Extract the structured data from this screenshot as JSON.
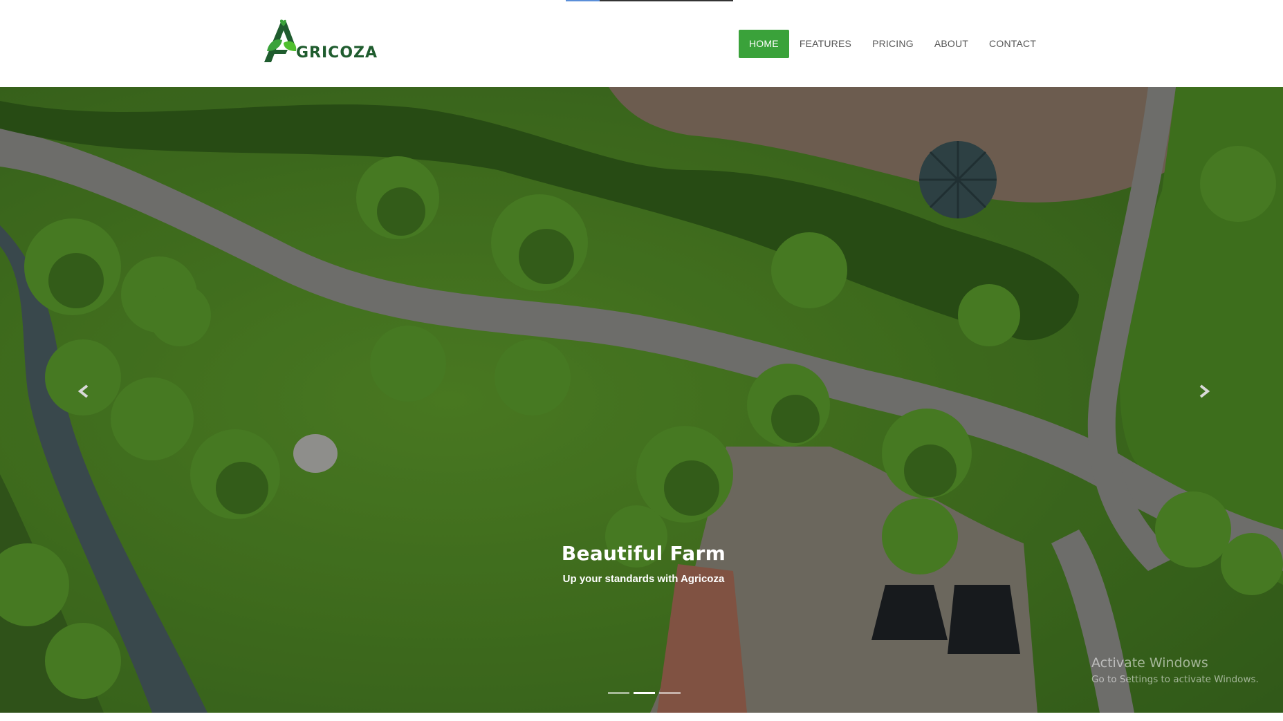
{
  "brand": {
    "name": "GRICOZA",
    "mark": "A"
  },
  "nav": {
    "items": [
      {
        "label": "HOME",
        "active": true
      },
      {
        "label": "FEATURES",
        "active": false
      },
      {
        "label": "PRICING",
        "active": false
      },
      {
        "label": "ABOUT",
        "active": false
      },
      {
        "label": "CONTACT",
        "active": false
      }
    ]
  },
  "hero": {
    "title": "Beautiful Farm",
    "subtitle": "Up your standards with Agricoza",
    "prev_icon": "chevron-left-icon",
    "next_icon": "chevron-right-icon",
    "slides_count": 3,
    "active_slide": 2
  },
  "watermark": {
    "line1": "Activate Windows",
    "line2": "Go to Settings to activate Windows."
  },
  "colors": {
    "accent": "#3aa23a",
    "nav_text": "#555555",
    "logo_dark": "#1f5c2e",
    "grass": "#4f8a25",
    "path": "#8a8a86"
  }
}
